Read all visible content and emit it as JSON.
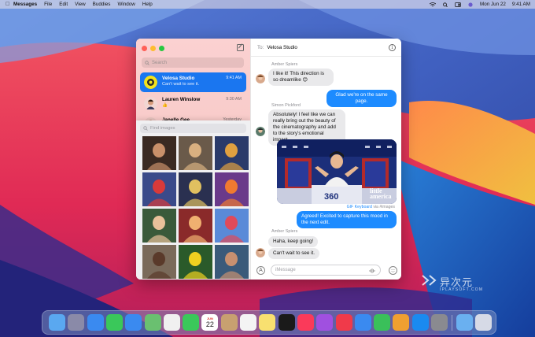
{
  "menubar": {
    "items": [
      "Messages",
      "File",
      "Edit",
      "View",
      "Buddies",
      "Window",
      "Help"
    ],
    "clock": "Mon Jun 22",
    "time": "9:41 AM"
  },
  "sidebar": {
    "search_placeholder": "Search",
    "conversations": [
      {
        "name": "Velosa Studio",
        "preview": "Can't wait to see it.",
        "time": "9:41 AM",
        "selected": true
      },
      {
        "name": "Lauren Winslow",
        "preview": "👍",
        "time": "9:30 AM",
        "selected": false
      },
      {
        "name": "Janelle Gee",
        "preview": "",
        "time": "Yesterday",
        "selected": false
      }
    ]
  },
  "gif_panel": {
    "search_placeholder": "Find images",
    "gif_count": 15
  },
  "chat": {
    "to_label": "To:",
    "recipient": "Velosa Studio",
    "messages": [
      {
        "sender": "Amber Spiers",
        "text": "I like it! This direction is so dreamlike 😊",
        "direction": "in"
      },
      {
        "text": "Glad we're on the same page.",
        "direction": "out"
      },
      {
        "sender": "Simon Pickford",
        "text": "Absolutely! I feel like we can really bring out the beauty of the cinematography and add to the story's emotional impact.",
        "direction": "in"
      },
      {
        "type": "gif",
        "gif_caption": "little america",
        "direction": "out"
      },
      {
        "text": "Agreed! Excited to capture this mood in the next edit.",
        "direction": "out"
      },
      {
        "sender": "Amber Spiers",
        "text": "Haha, keep going!",
        "direction": "in"
      },
      {
        "text": "Can't wait to see it.",
        "direction": "in"
      }
    ],
    "via_prefix": "GIF Keyboard",
    "via_suffix": "via #images",
    "input_placeholder": "iMessage"
  },
  "watermark": {
    "title": "异次元",
    "subtitle": "IPLAYSOFT.COM"
  },
  "dock": {
    "calendar_month": "JUN",
    "calendar_day": "22"
  },
  "colors": {
    "accent": "#1d8bff",
    "selected": "#1a76f0",
    "bubble_in": "#e9e9eb"
  }
}
